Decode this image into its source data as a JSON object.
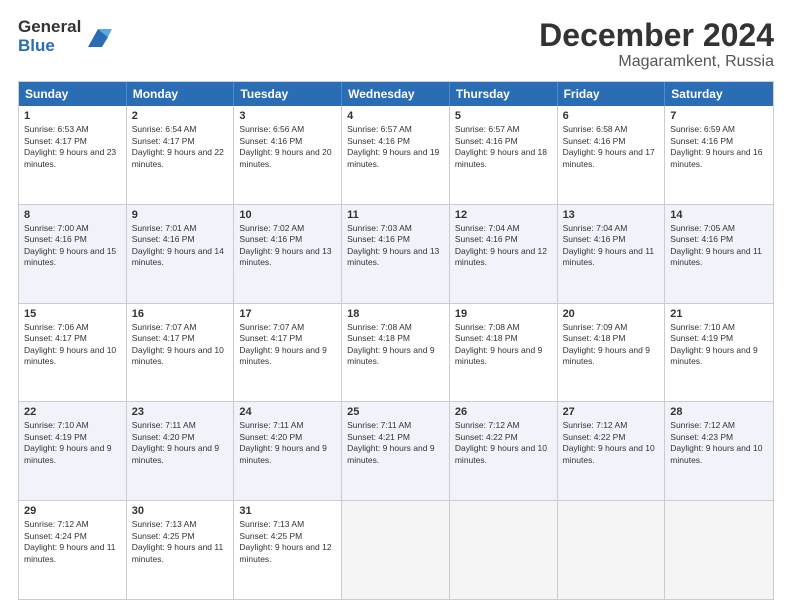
{
  "logo": {
    "general": "General",
    "blue": "Blue"
  },
  "title": "December 2024",
  "location": "Magaramkent, Russia",
  "days_of_week": [
    "Sunday",
    "Monday",
    "Tuesday",
    "Wednesday",
    "Thursday",
    "Friday",
    "Saturday"
  ],
  "weeks": [
    {
      "alt": false,
      "cells": [
        {
          "day": "1",
          "sunrise": "Sunrise: 6:53 AM",
          "sunset": "Sunset: 4:17 PM",
          "daylight": "Daylight: 9 hours and 23 minutes."
        },
        {
          "day": "2",
          "sunrise": "Sunrise: 6:54 AM",
          "sunset": "Sunset: 4:17 PM",
          "daylight": "Daylight: 9 hours and 22 minutes."
        },
        {
          "day": "3",
          "sunrise": "Sunrise: 6:56 AM",
          "sunset": "Sunset: 4:16 PM",
          "daylight": "Daylight: 9 hours and 20 minutes."
        },
        {
          "day": "4",
          "sunrise": "Sunrise: 6:57 AM",
          "sunset": "Sunset: 4:16 PM",
          "daylight": "Daylight: 9 hours and 19 minutes."
        },
        {
          "day": "5",
          "sunrise": "Sunrise: 6:57 AM",
          "sunset": "Sunset: 4:16 PM",
          "daylight": "Daylight: 9 hours and 18 minutes."
        },
        {
          "day": "6",
          "sunrise": "Sunrise: 6:58 AM",
          "sunset": "Sunset: 4:16 PM",
          "daylight": "Daylight: 9 hours and 17 minutes."
        },
        {
          "day": "7",
          "sunrise": "Sunrise: 6:59 AM",
          "sunset": "Sunset: 4:16 PM",
          "daylight": "Daylight: 9 hours and 16 minutes."
        }
      ]
    },
    {
      "alt": true,
      "cells": [
        {
          "day": "8",
          "sunrise": "Sunrise: 7:00 AM",
          "sunset": "Sunset: 4:16 PM",
          "daylight": "Daylight: 9 hours and 15 minutes."
        },
        {
          "day": "9",
          "sunrise": "Sunrise: 7:01 AM",
          "sunset": "Sunset: 4:16 PM",
          "daylight": "Daylight: 9 hours and 14 minutes."
        },
        {
          "day": "10",
          "sunrise": "Sunrise: 7:02 AM",
          "sunset": "Sunset: 4:16 PM",
          "daylight": "Daylight: 9 hours and 13 minutes."
        },
        {
          "day": "11",
          "sunrise": "Sunrise: 7:03 AM",
          "sunset": "Sunset: 4:16 PM",
          "daylight": "Daylight: 9 hours and 13 minutes."
        },
        {
          "day": "12",
          "sunrise": "Sunrise: 7:04 AM",
          "sunset": "Sunset: 4:16 PM",
          "daylight": "Daylight: 9 hours and 12 minutes."
        },
        {
          "day": "13",
          "sunrise": "Sunrise: 7:04 AM",
          "sunset": "Sunset: 4:16 PM",
          "daylight": "Daylight: 9 hours and 11 minutes."
        },
        {
          "day": "14",
          "sunrise": "Sunrise: 7:05 AM",
          "sunset": "Sunset: 4:16 PM",
          "daylight": "Daylight: 9 hours and 11 minutes."
        }
      ]
    },
    {
      "alt": false,
      "cells": [
        {
          "day": "15",
          "sunrise": "Sunrise: 7:06 AM",
          "sunset": "Sunset: 4:17 PM",
          "daylight": "Daylight: 9 hours and 10 minutes."
        },
        {
          "day": "16",
          "sunrise": "Sunrise: 7:07 AM",
          "sunset": "Sunset: 4:17 PM",
          "daylight": "Daylight: 9 hours and 10 minutes."
        },
        {
          "day": "17",
          "sunrise": "Sunrise: 7:07 AM",
          "sunset": "Sunset: 4:17 PM",
          "daylight": "Daylight: 9 hours and 9 minutes."
        },
        {
          "day": "18",
          "sunrise": "Sunrise: 7:08 AM",
          "sunset": "Sunset: 4:18 PM",
          "daylight": "Daylight: 9 hours and 9 minutes."
        },
        {
          "day": "19",
          "sunrise": "Sunrise: 7:08 AM",
          "sunset": "Sunset: 4:18 PM",
          "daylight": "Daylight: 9 hours and 9 minutes."
        },
        {
          "day": "20",
          "sunrise": "Sunrise: 7:09 AM",
          "sunset": "Sunset: 4:18 PM",
          "daylight": "Daylight: 9 hours and 9 minutes."
        },
        {
          "day": "21",
          "sunrise": "Sunrise: 7:10 AM",
          "sunset": "Sunset: 4:19 PM",
          "daylight": "Daylight: 9 hours and 9 minutes."
        }
      ]
    },
    {
      "alt": true,
      "cells": [
        {
          "day": "22",
          "sunrise": "Sunrise: 7:10 AM",
          "sunset": "Sunset: 4:19 PM",
          "daylight": "Daylight: 9 hours and 9 minutes."
        },
        {
          "day": "23",
          "sunrise": "Sunrise: 7:11 AM",
          "sunset": "Sunset: 4:20 PM",
          "daylight": "Daylight: 9 hours and 9 minutes."
        },
        {
          "day": "24",
          "sunrise": "Sunrise: 7:11 AM",
          "sunset": "Sunset: 4:20 PM",
          "daylight": "Daylight: 9 hours and 9 minutes."
        },
        {
          "day": "25",
          "sunrise": "Sunrise: 7:11 AM",
          "sunset": "Sunset: 4:21 PM",
          "daylight": "Daylight: 9 hours and 9 minutes."
        },
        {
          "day": "26",
          "sunrise": "Sunrise: 7:12 AM",
          "sunset": "Sunset: 4:22 PM",
          "daylight": "Daylight: 9 hours and 10 minutes."
        },
        {
          "day": "27",
          "sunrise": "Sunrise: 7:12 AM",
          "sunset": "Sunset: 4:22 PM",
          "daylight": "Daylight: 9 hours and 10 minutes."
        },
        {
          "day": "28",
          "sunrise": "Sunrise: 7:12 AM",
          "sunset": "Sunset: 4:23 PM",
          "daylight": "Daylight: 9 hours and 10 minutes."
        }
      ]
    },
    {
      "alt": false,
      "cells": [
        {
          "day": "29",
          "sunrise": "Sunrise: 7:12 AM",
          "sunset": "Sunset: 4:24 PM",
          "daylight": "Daylight: 9 hours and 11 minutes."
        },
        {
          "day": "30",
          "sunrise": "Sunrise: 7:13 AM",
          "sunset": "Sunset: 4:25 PM",
          "daylight": "Daylight: 9 hours and 11 minutes."
        },
        {
          "day": "31",
          "sunrise": "Sunrise: 7:13 AM",
          "sunset": "Sunset: 4:25 PM",
          "daylight": "Daylight: 9 hours and 12 minutes."
        },
        {
          "day": "",
          "sunrise": "",
          "sunset": "",
          "daylight": ""
        },
        {
          "day": "",
          "sunrise": "",
          "sunset": "",
          "daylight": ""
        },
        {
          "day": "",
          "sunrise": "",
          "sunset": "",
          "daylight": ""
        },
        {
          "day": "",
          "sunrise": "",
          "sunset": "",
          "daylight": ""
        }
      ]
    }
  ]
}
